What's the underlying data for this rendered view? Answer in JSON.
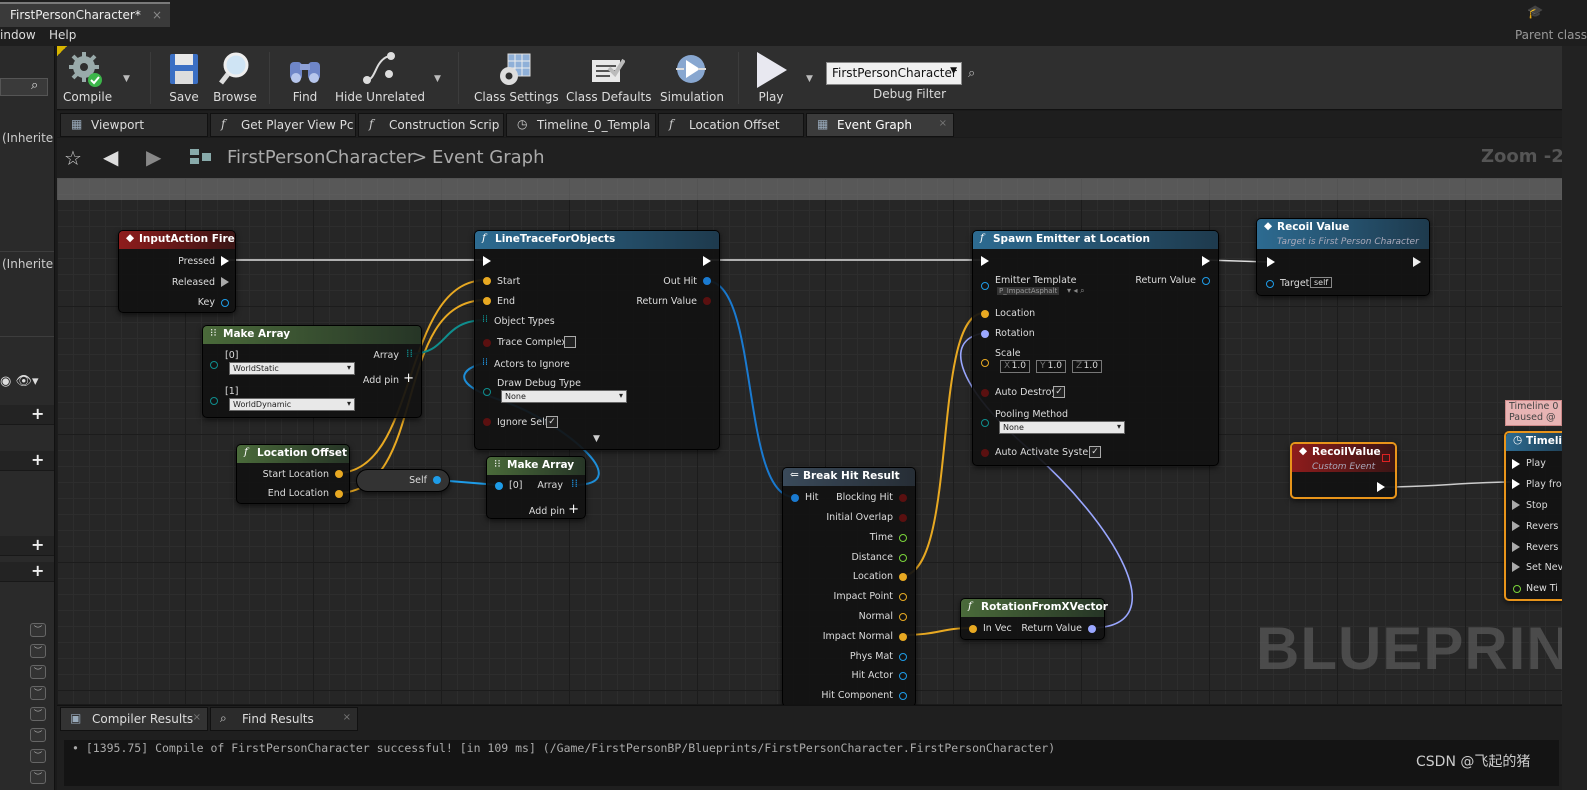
{
  "window": {
    "doc_tab": "FirstPersonCharacter*",
    "doc_tab_close": "×",
    "parent_class": "Parent class"
  },
  "menu": {
    "items": [
      "indow",
      "Help"
    ]
  },
  "toolbar": {
    "compile": "Compile",
    "save": "Save",
    "browse": "Browse",
    "find": "Find",
    "hide_unrelated": "Hide Unrelated",
    "class_settings": "Class Settings",
    "class_defaults": "Class Defaults",
    "simulation": "Simulation",
    "play": "Play",
    "debug_filter_value": "FirstPersonCharacter",
    "debug_filter_label": "Debug Filter"
  },
  "left_panel": {
    "inherited_1": "(Inherite",
    "inherited_2": "(Inherite"
  },
  "graph_tabs": [
    {
      "label": "Viewport",
      "icon": "viewport-icon"
    },
    {
      "label": "Get Player View Pc",
      "icon": "function-icon"
    },
    {
      "label": "Construction Scrip",
      "icon": "function-icon"
    },
    {
      "label": "Timeline_0_Templa",
      "icon": "timeline-icon"
    },
    {
      "label": "Location Offset",
      "icon": "function-icon"
    },
    {
      "label": "Event Graph",
      "icon": "event-graph-icon"
    }
  ],
  "breadcrumb": {
    "root": "FirstPersonCharacter",
    "separator": ">",
    "current": "Event Graph",
    "zoom": "Zoom -2"
  },
  "nodes": {
    "input_action": {
      "title": "InputAction Fire",
      "pins": [
        "Pressed",
        "Released",
        "Key"
      ]
    },
    "make_array_1": {
      "title": "Make Array",
      "pin0": "[0]",
      "val0": "WorldStatic",
      "pin1": "[1]",
      "val1": "WorldDynamic",
      "out": "Array",
      "add": "Add pin"
    },
    "location_offset": {
      "title": "Location Offset",
      "start": "Start Location",
      "end": "End Location"
    },
    "self": {
      "label": "Self"
    },
    "make_array_2": {
      "title": "Make Array",
      "pin0": "[0]",
      "out": "Array",
      "add": "Add pin"
    },
    "line_trace": {
      "title": "LineTraceForObjects",
      "start": "Start",
      "end": "End",
      "object_types": "Object Types",
      "trace_complex": "Trace Complex",
      "actors_to_ignore": "Actors to Ignore",
      "draw_debug": "Draw Debug Type",
      "draw_debug_value": "None",
      "ignore_self": "Ignore Self",
      "out_hit": "Out Hit",
      "return_value": "Return Value"
    },
    "break_hit": {
      "title": "Break Hit Result",
      "in": "Hit",
      "outs": [
        "Blocking Hit",
        "Initial Overlap",
        "Time",
        "Distance",
        "Location",
        "Impact Point",
        "Normal",
        "Impact Normal",
        "Phys Mat",
        "Hit Actor",
        "Hit Component"
      ]
    },
    "spawn_emitter": {
      "title": "Spawn Emitter at Location",
      "emitter_template": "Emitter Template",
      "emitter_value": "P_ImpactAsphalt",
      "location": "Location",
      "rotation": "Rotation",
      "scale": "Scale",
      "sx": "1.0",
      "sy": "1.0",
      "sz": "1.0",
      "ax": "X",
      "ay": "Y",
      "az": "Z",
      "auto_destroy": "Auto Destroy",
      "pooling": "Pooling Method",
      "pooling_value": "None",
      "auto_activate": "Auto Activate System",
      "return_value": "Return Value"
    },
    "rotation_from": {
      "title": "RotationFromXVector",
      "in": "In Vec",
      "out": "Return Value"
    },
    "recoil_value_call": {
      "title": "Recoil Value",
      "subtitle": "Target is First Person Character",
      "target": "Target",
      "target_value": "self"
    },
    "recoil_event": {
      "title": "RecoilValue",
      "subtitle": "Custom Event"
    },
    "timeline": {
      "title": "Timeli",
      "status_1": "Timeline 0",
      "status_2": "Paused @",
      "pins": [
        "Play",
        "Play fro",
        "Stop",
        "Revers",
        "Revers",
        "Set Nev",
        "New Ti"
      ]
    }
  },
  "watermark": "BLUEPRINT",
  "bottom": {
    "tabs": [
      "Compiler Results",
      "Find Results"
    ],
    "log": "• [1395.75] Compile of FirstPersonCharacter successful! [in 109 ms] (/Game/FirstPersonBP/Blueprints/FirstPersonCharacter.FirstPersonCharacter)"
  },
  "credit": "CSDN @飞起的猪",
  "colors": {
    "exec": "#ffffff",
    "vector": "#f5b92a",
    "object": "#1e9ce8",
    "struct": "#1a7ad0",
    "rotator": "#9aa7ff",
    "bool": "#8a1010",
    "float": "#7ad43a",
    "array_teal": "#128e8e",
    "event_red": "#8e1c1c",
    "function_blue": "#2d6b91",
    "pure_green": "#4a6a3a"
  }
}
